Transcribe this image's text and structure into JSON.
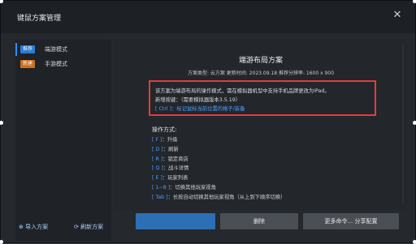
{
  "window": {
    "title": "键鼠方案管理",
    "close_icon": "close-icon"
  },
  "sidebar": {
    "items": [
      {
        "badge": "推荐",
        "badge_color": "#2b7cd3",
        "label": "端游模式",
        "active": true
      },
      {
        "badge": "新建",
        "badge_color": "#c96f1f",
        "label": "手游模式",
        "active": false
      }
    ],
    "import_label": "导入方案",
    "refresh_label": "刷新方案"
  },
  "plan": {
    "title": "端游布局方案",
    "meta": "方案类型: 云方案  更新时间: 2023.09.18  推荐分辨率: 1600 x 900",
    "description": [
      "该方案为端游布局的操作模式，需在模拟器机型中支持手机品牌更改为iPad。",
      "新增按键：（需要模拟器版本3.5.19）",
      "[ Ctrl ]：标记鼠标当前位置的格子/装备"
    ],
    "ops_title": "操作方式:",
    "ops": [
      {
        "key": "[ F ]",
        "text": "：升级"
      },
      {
        "key": "[ D ]",
        "text": "：刷新"
      },
      {
        "key": "[ R ]",
        "text": "：锁定商店"
      },
      {
        "key": "[ Q ]",
        "text": "：战斗详情"
      },
      {
        "key": "[ E ]",
        "text": "：玩家列表"
      },
      {
        "key": "[ 1~8 ]",
        "text": "：切换其他玩家视角"
      },
      {
        "key": "[ Tab ]",
        "text": "：长按自动切换其他玩家视角（从上到下顺序切换）"
      }
    ]
  },
  "actions": {
    "primary_label": "",
    "delete_label": "删除",
    "more_label": "更多命令... 分享配置"
  },
  "colors": {
    "accent": "#2f8ff0",
    "highlight_border": "#e33d3a",
    "key_color": "#4ba3ff"
  }
}
